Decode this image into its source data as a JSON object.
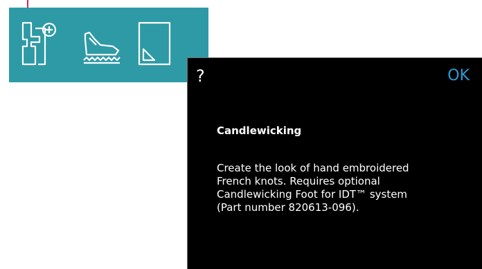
{
  "colors": {
    "toolbar_bg": "#2e9aa6",
    "icon_stroke": "#ffffff",
    "pointer": "#d9224b",
    "dialog_bg": "#000000",
    "ok_accent": "#2a9bd8"
  },
  "toolbar": {
    "icons": [
      "presser-foot-add-icon",
      "presser-foot-icon",
      "fabric-corner-icon"
    ]
  },
  "dialog": {
    "help_symbol": "?",
    "ok_label": "OK",
    "title": "Candlewicking",
    "body_lines": [
      "Create the look of hand embroidered",
      "French knots. Requires optional",
      "Candlewicking Foot for IDT™ system",
      "(Part number 820613-096)."
    ]
  }
}
